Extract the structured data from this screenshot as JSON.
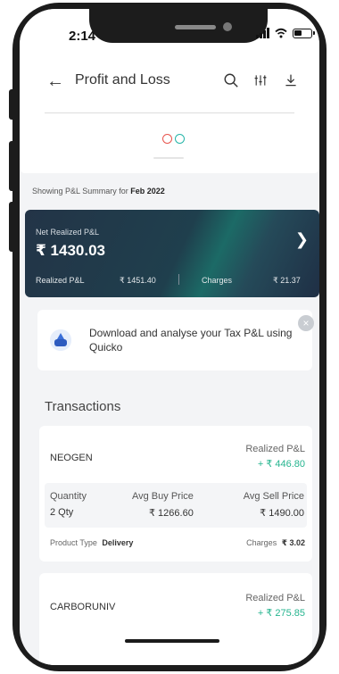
{
  "status_bar": {
    "time": "2:14"
  },
  "header": {
    "title": "Profit and Loss",
    "back_icon": "arrow-left-icon",
    "search_icon": "search-icon",
    "filter_icon": "sliders-icon",
    "download_icon": "download-icon"
  },
  "summary": {
    "showing_prefix": "Showing P&L Summary for ",
    "period": "Feb 2022"
  },
  "net_card": {
    "label": "Net Realized P&L",
    "value": "₹ 1430.03",
    "realized_label": "Realized P&L",
    "realized_value": "₹ 1451.40",
    "charges_label": "Charges",
    "charges_value": "₹ 21.37"
  },
  "banner": {
    "text": "Download and analyse your Tax P&L using Quicko",
    "close": "×"
  },
  "transactions": {
    "heading": "Transactions",
    "items": [
      {
        "symbol": "NEOGEN",
        "realized_label": "Realized P&L",
        "realized_value": "+ ₹ 446.80",
        "quantity_label": "Quantity",
        "quantity": "2 Qty",
        "avg_buy_label": "Avg Buy Price",
        "avg_buy": "₹ 1266.60",
        "avg_sell_label": "Avg Sell Price",
        "avg_sell": "₹ 1490.00",
        "product_type_label": "Product Type",
        "product_type": "Delivery",
        "charges_label": "Charges",
        "charges": "₹ 3.02"
      },
      {
        "symbol": "CARBORUNIV",
        "realized_label": "Realized P&L",
        "realized_value": "+ ₹ 275.85"
      }
    ]
  },
  "colors": {
    "positive": "#26b58f",
    "card_dark": "#233447",
    "card_teal": "#1c6a66",
    "dot_red": "#e8554e",
    "dot_teal": "#26b5a8"
  }
}
